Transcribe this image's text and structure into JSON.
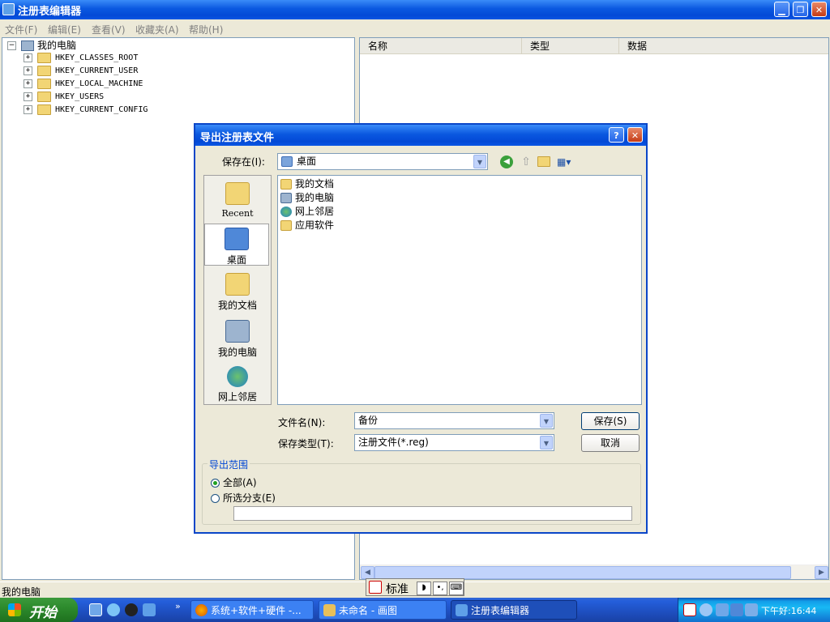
{
  "window": {
    "title": "注册表编辑器",
    "menu": [
      "文件(F)",
      "编辑(E)",
      "查看(V)",
      "收藏夹(A)",
      "帮助(H)"
    ]
  },
  "tree": {
    "root": "我的电脑",
    "keys": [
      "HKEY_CLASSES_ROOT",
      "HKEY_CURRENT_USER",
      "HKEY_LOCAL_MACHINE",
      "HKEY_USERS",
      "HKEY_CURRENT_CONFIG"
    ]
  },
  "list": {
    "columns": [
      "名称",
      "类型",
      "数据"
    ]
  },
  "status": {
    "path": "我的电脑"
  },
  "ime": {
    "mode": "标准"
  },
  "dialog": {
    "title": "导出注册表文件",
    "help_glyph": "?",
    "close_glyph": "✕",
    "save_in_label": "保存在(I):",
    "save_in_value": "桌面",
    "places": [
      "Recent",
      "桌面",
      "我的文档",
      "我的电脑",
      "网上邻居"
    ],
    "files": [
      "我的文档",
      "我的电脑",
      "网上邻居",
      "应用软件"
    ],
    "filename_label": "文件名(N):",
    "filename_value": "备份",
    "filetype_label": "保存类型(T):",
    "filetype_value": "注册文件(*.reg)",
    "save_button": "保存(S)",
    "cancel_button": "取消",
    "export_range_label": "导出范围",
    "option_all": "全部(A)",
    "option_branch": "所选分支(E)",
    "branch_value": ""
  },
  "taskbar": {
    "start": "开始",
    "tasks": [
      "系统+软件+硬件 -...",
      "未命名 - 画图",
      "注册表编辑器"
    ],
    "clock": "下午好:16:44"
  },
  "colors": {
    "titlebar_blue": "#0A58E0",
    "taskbar_blue": "#245EDB",
    "start_green": "#2D8B2D"
  }
}
